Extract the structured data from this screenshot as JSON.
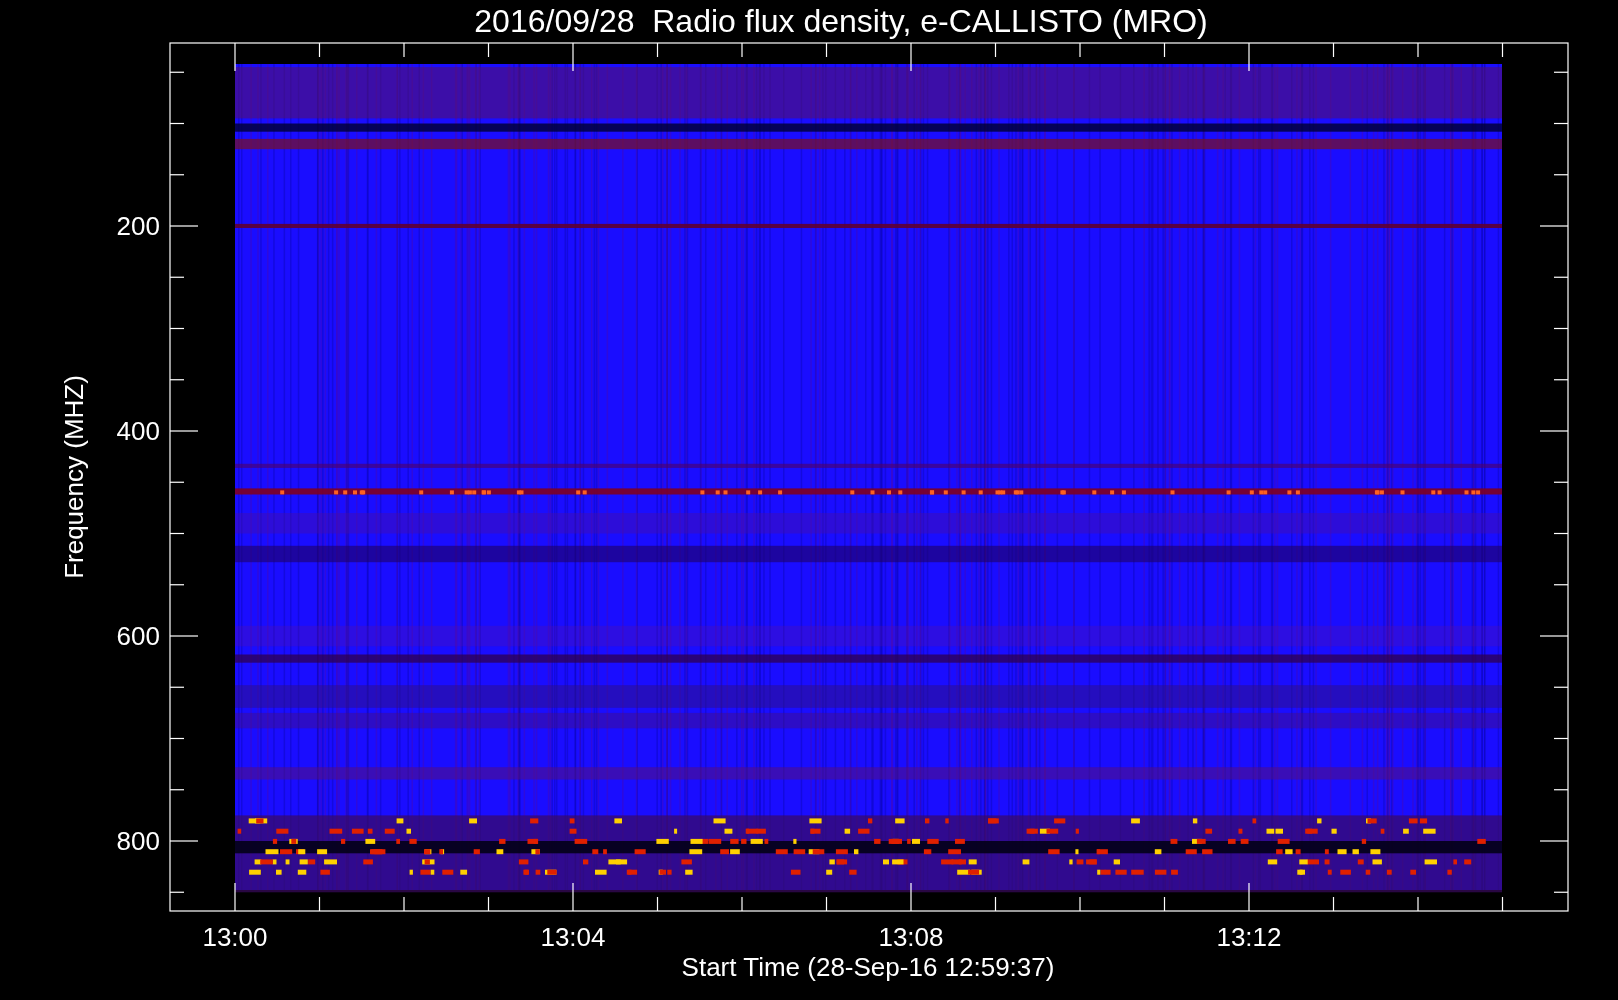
{
  "title": "2016/09/28  Radio flux density, e-CALLISTO (MRO)",
  "y_axis": {
    "label": "Frequency (MHZ)",
    "ticks": [
      "200",
      "400",
      "600",
      "800"
    ]
  },
  "x_axis": {
    "label": "Start Time (28-Sep-16 12:59:37)",
    "ticks": [
      "13:00",
      "13:04",
      "13:08",
      "13:12"
    ]
  }
}
